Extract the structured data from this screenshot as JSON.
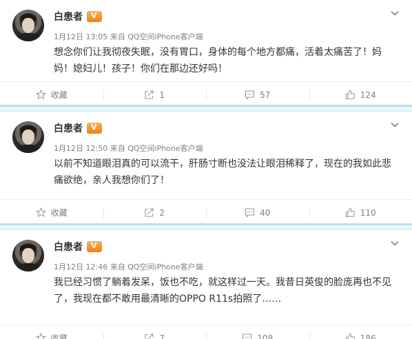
{
  "posts": [
    {
      "author": "白患者",
      "date": "1月12日 13:05",
      "source": "来自 QQ空间iPhone客户端",
      "text": "想念你们让我彻夜失眠，没有胃口，身体的每个地方都痛，活着太痛苦了！妈妈！媳妇儿！孩子！你们在那边还好吗！",
      "favorite_label": "收藏",
      "reposts": "1",
      "comments": "57",
      "likes": "124"
    },
    {
      "author": "白患者",
      "date": "1月12日 12:50",
      "source": "来自 QQ空间iPhone客户端",
      "text": "以前不知道眼泪真的可以流干，肝肠寸断也没法让眼泪稀释了，现在的我如此悲痛欲绝，亲人我想你们了！",
      "favorite_label": "收藏",
      "reposts": "2",
      "comments": "40",
      "likes": "110"
    },
    {
      "author": "白患者",
      "date": "1月12日 12:46",
      "source": "来自 QQ空间iPhone客户端",
      "text": "我已经习惯了躺着发呆，饭也不吃，就这样过一天。我昔日英俊的脸庞再也不见了，我现在都不敢用最清晰的OPPO R11s拍照了……",
      "favorite_label": "收藏",
      "reposts": "7",
      "comments": "108",
      "likes": "186"
    }
  ],
  "icons": {
    "vip_badge": "vip-crown-icon",
    "menu": "chevron-down-icon",
    "favorite": "star-icon",
    "repost": "repost-icon",
    "comment": "comment-icon",
    "like": "thumbs-up-icon"
  },
  "colors": {
    "separator": "#b9e0ee",
    "meta_text": "#808080",
    "body_text": "#333333",
    "vip_badge": "#f07d1d"
  }
}
